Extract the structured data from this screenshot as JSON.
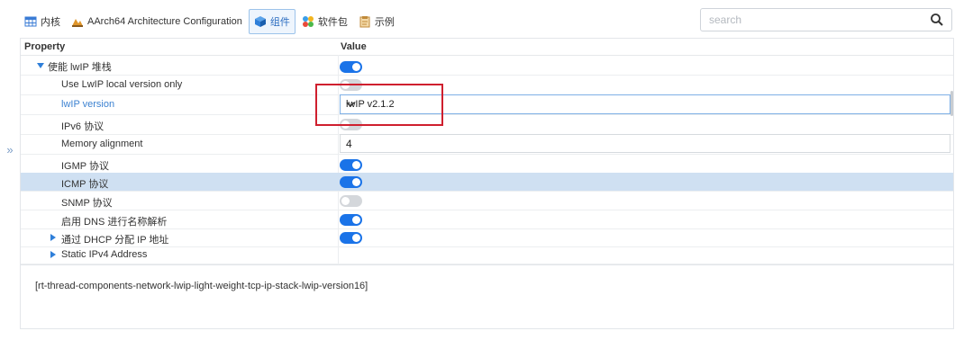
{
  "tabs": [
    {
      "label": "内核",
      "icon": "kernel-icon",
      "active": false
    },
    {
      "label": "AArch64 Architecture Configuration",
      "icon": "architecture-icon",
      "active": false
    },
    {
      "label": "组件",
      "icon": "component-icon",
      "active": true
    },
    {
      "label": "软件包",
      "icon": "package-icon",
      "active": false
    },
    {
      "label": "示例",
      "icon": "example-icon",
      "active": false
    }
  ],
  "search": {
    "placeholder": "search",
    "icon": "search-icon"
  },
  "collapse": {
    "label": "»",
    "icon": "double-chevron-right-icon"
  },
  "table": {
    "property_header": "Property",
    "value_header": "Value",
    "rows": [
      {
        "label": "使能 lwIP 堆栈",
        "expander": "expanded",
        "value_type": "toggle",
        "value": true
      },
      {
        "label": "Use LwIP local version only",
        "value_type": "toggle",
        "value": false
      },
      {
        "label": "lwIP version",
        "value_type": "select",
        "value": "lwIP v2.1.2",
        "highlight": true
      },
      {
        "label": "IPv6 协议",
        "value_type": "toggle",
        "value": false
      },
      {
        "label": "Memory alignment",
        "value_type": "number",
        "value": "4"
      },
      {
        "label": "IGMP 协议",
        "value_type": "toggle",
        "value": true
      },
      {
        "label": "ICMP 协议",
        "value_type": "toggle",
        "value": true,
        "selected": true
      },
      {
        "label": "SNMP 协议",
        "value_type": "toggle",
        "value": false
      },
      {
        "label": "启用 DNS 进行名称解析",
        "value_type": "toggle",
        "value": true
      },
      {
        "label": "通过 DHCP 分配 IP 地址",
        "expander": "collapsed",
        "value_type": "toggle",
        "value": true
      },
      {
        "label": "Static IPv4 Address",
        "expander": "collapsed",
        "value_type": "none"
      }
    ]
  },
  "description": "[rt-thread-components-network-lwip-light-weight-tcp-ip-stack-lwip-version16]",
  "colors": {
    "accent": "#1a73e8",
    "selected_row": "#cfe0f2",
    "annotation": "#cf1f2e",
    "link_label": "#3c82d1"
  }
}
